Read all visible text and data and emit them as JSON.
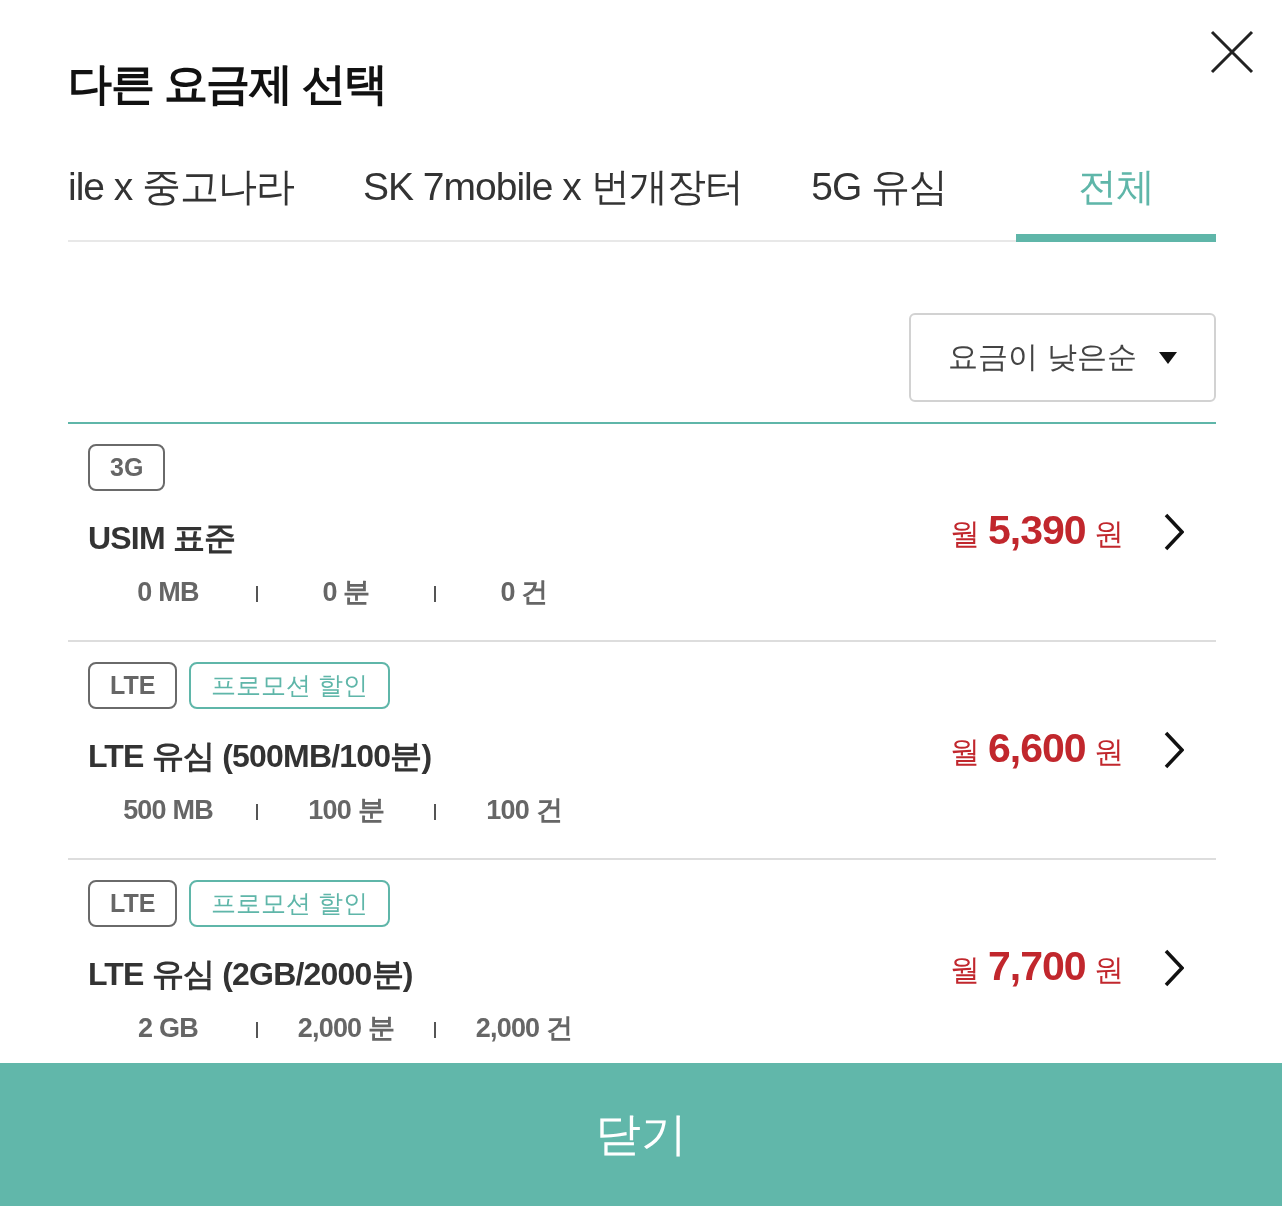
{
  "dialog": {
    "title": "다른 요금제 선택"
  },
  "tabs": [
    {
      "label": "ile x 중고나라",
      "selected": false
    },
    {
      "label": "SK 7mobile x 번개장터",
      "selected": false
    },
    {
      "label": "5G 유심",
      "selected": false
    },
    {
      "label": "전체",
      "selected": true
    }
  ],
  "sort": {
    "value": "요금이 낮은순"
  },
  "plans": [
    {
      "tags": [
        {
          "kind": "network",
          "label": "3G"
        }
      ],
      "name": "USIM 표준",
      "stats": [
        "0 MB",
        "0 분",
        "0 건"
      ],
      "price": "월 **5,390** 원"
    },
    {
      "tags": [
        {
          "kind": "network",
          "label": "LTE"
        },
        {
          "kind": "promo",
          "label": "프로모션 할인"
        }
      ],
      "name": "LTE 유심 (500MB/100분)",
      "stats": [
        "500 MB",
        "100 분",
        "100 건"
      ],
      "price": "월 **6,600** 원"
    },
    {
      "tags": [
        {
          "kind": "network",
          "label": "LTE"
        },
        {
          "kind": "promo",
          "label": "프로모션 할인"
        }
      ],
      "name": "LTE 유심 (2GB/2000분)",
      "stats": [
        "2 GB",
        "2,000 분",
        "2,000 건"
      ],
      "price": "월 **7,700** 원"
    }
  ],
  "footer_button": {
    "label": "닫기"
  }
}
